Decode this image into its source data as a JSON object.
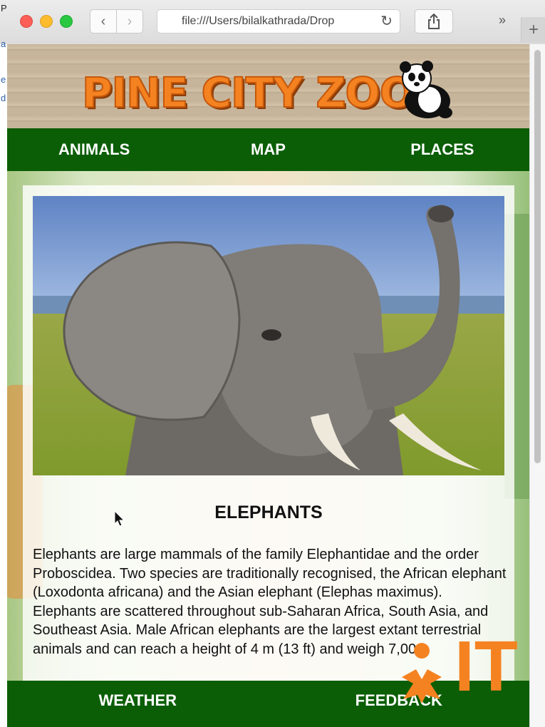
{
  "browser": {
    "url": "file:///Users/bilalkathrada/Drop",
    "back_icon": "chevron-left-icon",
    "forward_icon": "chevron-right-icon",
    "reload_icon": "reload-icon",
    "share_icon": "share-icon",
    "overflow_label": "»",
    "new_tab_label": "+"
  },
  "edge_text": [
    "P",
    "a",
    "e",
    "d"
  ],
  "site": {
    "logo": "PINE CITY ZOO",
    "brand_color": "#f58220",
    "nav_color": "#0b5e06"
  },
  "nav": [
    {
      "label": "ANIMALS"
    },
    {
      "label": "MAP"
    },
    {
      "label": "PLACES"
    }
  ],
  "article": {
    "title": "ELEPHANTS",
    "text": "Elephants are large mammals of the family Elephantidae and the order Proboscidea. Two species are traditionally recognised, the African elephant (Loxodonta africana) and the Asian elephant (Elephas maximus). Elephants are scattered throughout sub-Saharan Africa, South Asia, and Southeast Asia. Male African elephants are the largest extant terrestrial animals and can reach a height of 4 m (13 ft) and weigh 7,000"
  },
  "footer": [
    {
      "label": "WEATHER"
    },
    {
      "label": "FEEDBACK"
    }
  ],
  "watermark": "IT"
}
